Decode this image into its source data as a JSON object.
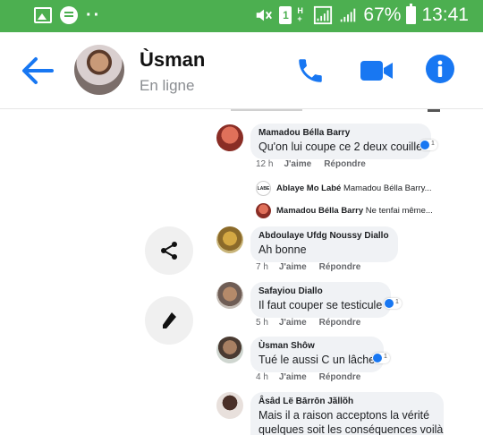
{
  "status_bar": {
    "battery": "67%",
    "time": "13:41",
    "sim": "1"
  },
  "header": {
    "contact_name": "Ùsman",
    "contact_status": "En ligne"
  },
  "comments": [
    {
      "name": "Mamadou Bélla Barry",
      "text": "Qu'on lui coupe ce 2 deux couille",
      "time": "12 h",
      "like": "J'aime",
      "reply": "Répondre",
      "reactions": "1"
    },
    {
      "name": "Abdoulaye Ufdg Noussy Diallo",
      "text": "Ah bonne",
      "time": "7 h",
      "like": "J'aime",
      "reply": "Répondre",
      "reactions": ""
    },
    {
      "name": "Safayiou Diallo",
      "text": "Il faut couper se testicule",
      "time": "5 h",
      "like": "J'aime",
      "reply": "Répondre",
      "reactions": "1"
    },
    {
      "name": "Ùsman Shôw",
      "text": "Tué le aussi C un lâche",
      "time": "4 h",
      "like": "J'aime",
      "reply": "Répondre",
      "reactions": "1"
    },
    {
      "name": "Âsâd Lë Bārrōn Jãllõh",
      "text_line1": "Mais il a raison acceptons la vérité",
      "text_line2": "quelques soit les conséquences voilà"
    }
  ],
  "replies": [
    {
      "name": "Ablaye Mo Labé",
      "text": "Mamadou Bélla Barry...",
      "avatar_label": "LABE"
    },
    {
      "name": "Mamadou Bélla Barry",
      "text": "Ne tenfai même..."
    }
  ]
}
